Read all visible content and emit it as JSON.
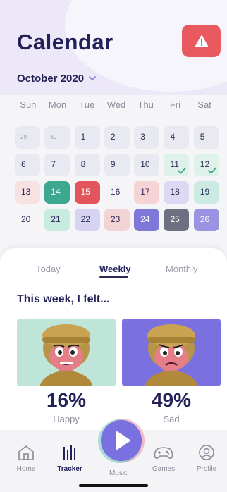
{
  "header": {
    "title": "Calendar",
    "month": "October 2020"
  },
  "calendar": {
    "weekdays": [
      "Sun",
      "Mon",
      "Tue",
      "Wed",
      "Thu",
      "Fri",
      "Sat"
    ],
    "days": [
      {
        "label": "29",
        "fill": "#e9e9f2",
        "muted": true
      },
      {
        "label": "30",
        "fill": "#e9e9f2",
        "muted": true
      },
      {
        "label": "1",
        "fill": "#e9e9f2"
      },
      {
        "label": "2",
        "fill": "#e9e9f2"
      },
      {
        "label": "3",
        "fill": "#e9e9f2"
      },
      {
        "label": "4",
        "fill": "#e9e9f2"
      },
      {
        "label": "5",
        "fill": "#e9e9f2"
      },
      {
        "label": "6",
        "fill": "#e9e9f2"
      },
      {
        "label": "7",
        "fill": "#e9e9f2"
      },
      {
        "label": "8",
        "fill": "#e9e9f2"
      },
      {
        "label": "9",
        "fill": "#e9e9f2"
      },
      {
        "label": "10",
        "fill": "#e9e9f2"
      },
      {
        "label": "11",
        "fill": "#dff2ea",
        "check": true
      },
      {
        "label": "12",
        "fill": "#dff2ea",
        "check": true
      },
      {
        "label": "13",
        "fill": "#f7e1e1"
      },
      {
        "label": "14",
        "fill": "#3ea88f",
        "text": "#ffffff"
      },
      {
        "label": "15",
        "fill": "#e2555c",
        "text": "#ffffff"
      },
      {
        "label": "16",
        "fill": "#f5f5f8"
      },
      {
        "label": "17",
        "fill": "#f6d4d6"
      },
      {
        "label": "18",
        "fill": "#ddd9f3"
      },
      {
        "label": "19",
        "fill": "#cbeae1"
      },
      {
        "label": "20",
        "fill": "#f5f5f8"
      },
      {
        "label": "21",
        "fill": "#c8ebdf"
      },
      {
        "label": "22",
        "fill": "#d7d3f2"
      },
      {
        "label": "23",
        "fill": "#f4d3d4"
      },
      {
        "label": "24",
        "fill": "#7f78d8",
        "text": "#ffffff"
      },
      {
        "label": "25",
        "fill": "#6f6f82",
        "text": "#ffffff"
      },
      {
        "label": "26",
        "fill": "#9993e2",
        "text": "#ffffff"
      }
    ]
  },
  "tabs": {
    "today": "Today",
    "weekly": "Weekly",
    "monthly": "Monthly"
  },
  "summary": {
    "heading": "This week, I felt...",
    "moods": [
      {
        "percent": "16%",
        "label": "Happy",
        "card_color": "#bfe4d8"
      },
      {
        "percent": "49%",
        "label": "Sad",
        "card_color": "#7a70e0"
      }
    ]
  },
  "nav": {
    "items": [
      {
        "label": "Home",
        "icon": "home-icon"
      },
      {
        "label": "Tracker",
        "icon": "tracker-icon"
      },
      {
        "label": "Music",
        "icon": "music-icon"
      },
      {
        "label": "Games",
        "icon": "gamepad-icon"
      },
      {
        "label": "Profile",
        "icon": "profile-icon"
      }
    ]
  },
  "colors": {
    "accent": "#232158",
    "alert": "#e85a5f",
    "play": "#7a70e0"
  }
}
